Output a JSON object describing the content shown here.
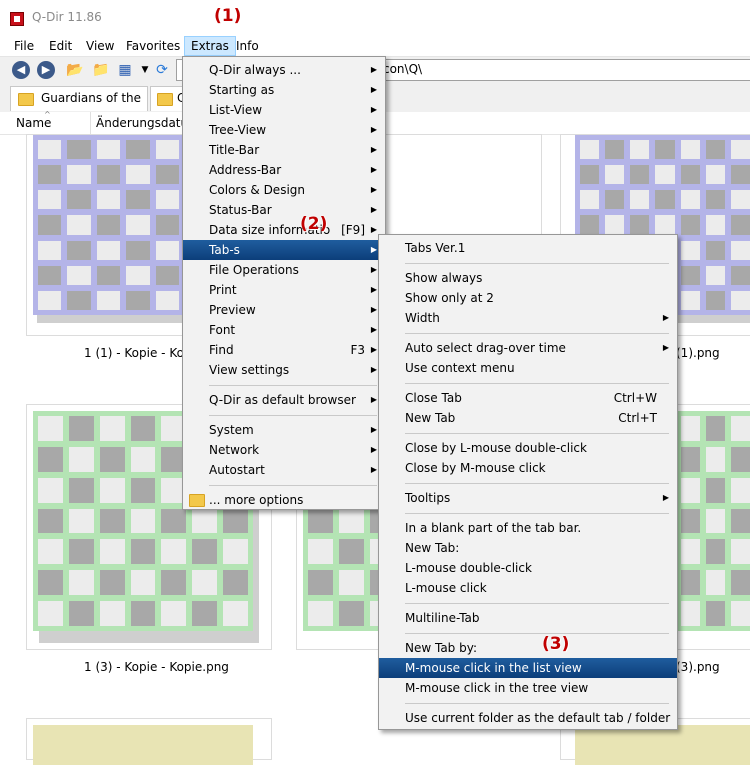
{
  "window": {
    "title": "Q-Dir 11.86"
  },
  "menubar": [
    "File",
    "Edit",
    "View",
    "Favorites",
    "Extras",
    "Info"
  ],
  "address": "g\\icon\\Q\\",
  "tabs": {
    "first": "Guardians of the ...",
    "second": "C"
  },
  "columns": {
    "name": "Name",
    "date": "Änderungsdatum"
  },
  "thumbnails": {
    "row1_left": "1 (1) - Kopie - Kopi",
    "row1_right": "(1).png",
    "row2_left": "1 (3) - Kopie - Kopie.png",
    "row2_right": "(3).png"
  },
  "extras_menu": [
    {
      "label": "Q-Dir always ...",
      "sub": true
    },
    {
      "label": "Starting as",
      "sub": true
    },
    {
      "label": "List-View",
      "sub": true
    },
    {
      "label": "Tree-View",
      "sub": true
    },
    {
      "label": "Title-Bar",
      "sub": true
    },
    {
      "label": "Address-Bar",
      "sub": true
    },
    {
      "label": "Colors & Design",
      "sub": true
    },
    {
      "label": "Status-Bar",
      "sub": true
    },
    {
      "label": "Data size informatio",
      "accel": "[F9]",
      "sub": true
    },
    {
      "label": "Tab-s",
      "sub": true,
      "selected": true
    },
    {
      "label": "File Operations",
      "sub": true
    },
    {
      "label": "Print",
      "sub": true
    },
    {
      "label": "Preview",
      "sub": true
    },
    {
      "label": "Font",
      "sub": true
    },
    {
      "label": "Find",
      "accel": "F3",
      "sub": true
    },
    {
      "label": "View settings",
      "sub": true
    },
    {
      "sep": true
    },
    {
      "label": "Q-Dir as default browser",
      "sub": true
    },
    {
      "sep": true
    },
    {
      "label": "System",
      "sub": true
    },
    {
      "label": "Network",
      "sub": true
    },
    {
      "label": "Autostart",
      "sub": true
    },
    {
      "sep": true
    },
    {
      "label": "... more options",
      "folder": true
    }
  ],
  "tabs_menu": [
    {
      "label": "Tabs Ver.1"
    },
    {
      "sep": true
    },
    {
      "label": "Show always"
    },
    {
      "label": "Show only at 2"
    },
    {
      "label": "Width",
      "sub": true
    },
    {
      "sep": true
    },
    {
      "label": "Auto select drag-over time",
      "sub": true
    },
    {
      "label": "Use context menu"
    },
    {
      "sep": true
    },
    {
      "label": "Close Tab",
      "accel": "Ctrl+W"
    },
    {
      "label": "New Tab",
      "accel": "Ctrl+T"
    },
    {
      "sep": true
    },
    {
      "label": "Close by L-mouse double-click"
    },
    {
      "label": "Close by M-mouse click"
    },
    {
      "sep": true
    },
    {
      "label": "Tooltips",
      "sub": true
    },
    {
      "sep": true
    },
    {
      "label": "In a blank part of the tab bar."
    },
    {
      "label": "New Tab:"
    },
    {
      "label": "L-mouse double-click"
    },
    {
      "label": "L-mouse click"
    },
    {
      "sep": true
    },
    {
      "label": "Multiline-Tab"
    },
    {
      "sep": true
    },
    {
      "label": "New Tab by:"
    },
    {
      "label": "M-mouse click in the list view",
      "selected": true
    },
    {
      "label": "M-mouse click in the tree view"
    },
    {
      "sep": true
    },
    {
      "label": "Use current folder as the default tab / folder"
    }
  ],
  "badges": [
    "(1)",
    "(2)",
    "(3)"
  ],
  "colors": {
    "selection": "#0c3e7a",
    "badge": "#c00000",
    "thumb_blue": "#b4b4e8",
    "thumb_green": "#b4e4b4",
    "thumb_yellow": "#e8e4b4"
  }
}
